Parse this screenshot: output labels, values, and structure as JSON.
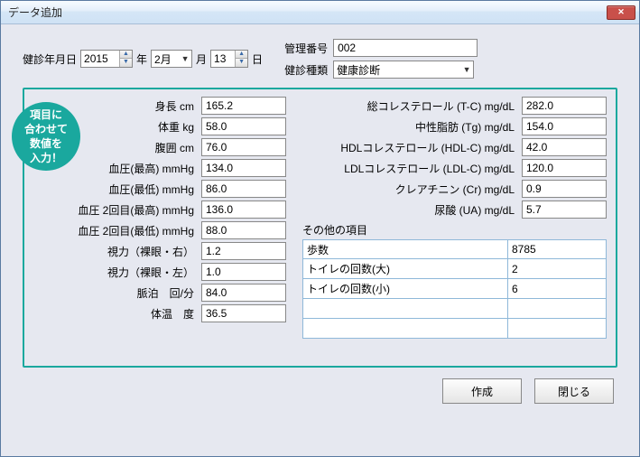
{
  "window": {
    "title": "データ追加"
  },
  "date": {
    "label": "健診年月日",
    "year": "2015",
    "year_unit": "年",
    "month": "2月",
    "month_unit": "月",
    "day": "13",
    "day_unit": "日"
  },
  "mgmt": {
    "id_label": "管理番号",
    "id_value": "002",
    "type_label": "健診種類",
    "type_value": "健康診断"
  },
  "callout": "項目に\n合わせて\n数値を\n入力！",
  "left_fields": [
    {
      "label": "身長 cm",
      "value": "165.2"
    },
    {
      "label": "体重 kg",
      "value": "58.0"
    },
    {
      "label": "腹囲 cm",
      "value": "76.0"
    },
    {
      "label": "血圧(最高) mmHg",
      "value": "134.0"
    },
    {
      "label": "血圧(最低) mmHg",
      "value": "86.0"
    },
    {
      "label": "血圧 2回目(最高) mmHg",
      "value": "136.0"
    },
    {
      "label": "血圧 2回目(最低) mmHg",
      "value": "88.0"
    },
    {
      "label": "視力（裸眼・右）",
      "value": "1.2"
    },
    {
      "label": "視力（裸眼・左）",
      "value": "1.0"
    },
    {
      "label": "脈泊　回/分",
      "value": "84.0"
    },
    {
      "label": "体温　度",
      "value": "36.5"
    }
  ],
  "right_fields": [
    {
      "label": "総コレステロール (T-C) mg/dL",
      "value": "282.0"
    },
    {
      "label": "中性脂肪 (Tg) mg/dL",
      "value": "154.0"
    },
    {
      "label": "HDLコレステロール (HDL-C) mg/dL",
      "value": "42.0"
    },
    {
      "label": "LDLコレステロール (LDL-C) mg/dL",
      "value": "120.0"
    },
    {
      "label": "クレアチニン (Cr) mg/dL",
      "value": "0.9"
    },
    {
      "label": "尿酸 (UA) mg/dL",
      "value": "5.7"
    }
  ],
  "other": {
    "header": "その他の項目",
    "rows": [
      {
        "name": "歩数",
        "value": "8785"
      },
      {
        "name": "トイレの回数(大)",
        "value": "2"
      },
      {
        "name": "トイレの回数(小)",
        "value": "6"
      },
      {
        "name": "",
        "value": ""
      },
      {
        "name": "",
        "value": ""
      }
    ]
  },
  "buttons": {
    "create": "作成",
    "close": "閉じる"
  }
}
